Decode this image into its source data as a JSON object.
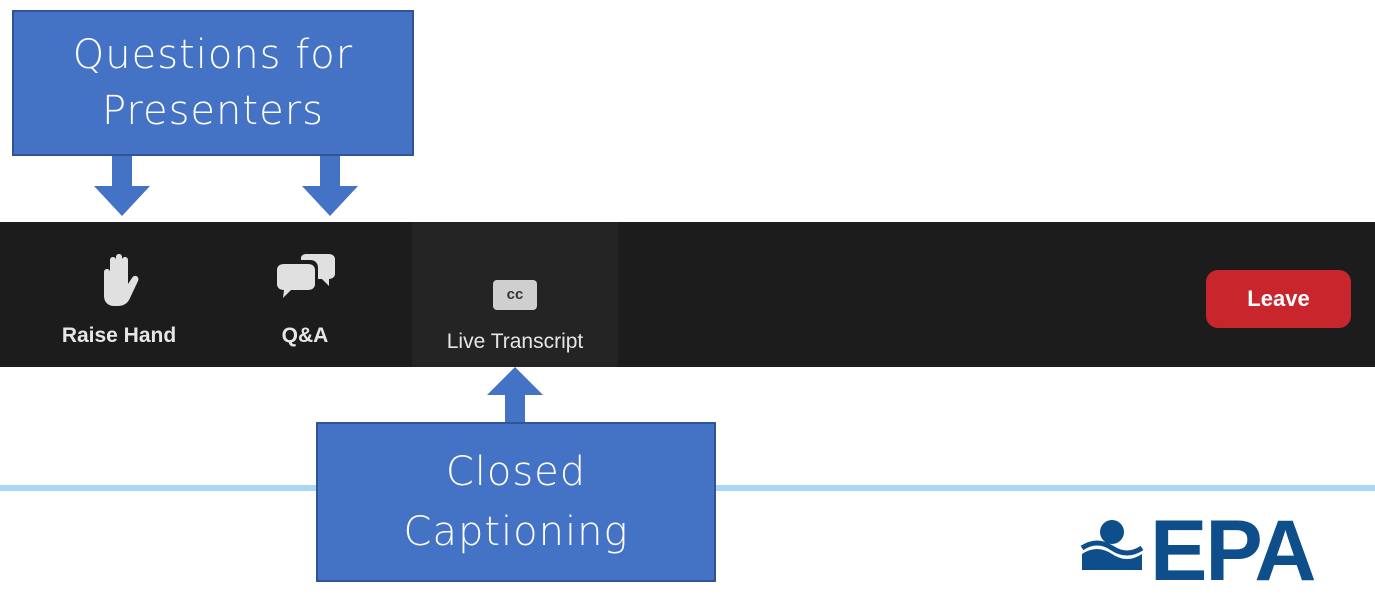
{
  "callouts": {
    "top": {
      "line1": "Questions for",
      "line2": "Presenters"
    },
    "bottom": {
      "line1": "Closed",
      "line2": "Captioning"
    }
  },
  "toolbar": {
    "raise_hand": {
      "label": "Raise Hand",
      "icon": "hand-icon"
    },
    "qa": {
      "label": "Q&A",
      "icon": "chat-bubbles-icon"
    },
    "live_transcript": {
      "label": "Live Transcript",
      "icon_text": "cc",
      "icon": "closed-captions-icon"
    },
    "leave": {
      "label": "Leave"
    }
  },
  "logo": {
    "text": "EPA",
    "icon": "epa-logo"
  },
  "colors": {
    "callout": "#4472c4",
    "toolbar_bg": "#1c1c1c",
    "leave_red": "#c8262c",
    "divider": "#a9d5f7",
    "epa_blue": "#0e4e8a"
  }
}
